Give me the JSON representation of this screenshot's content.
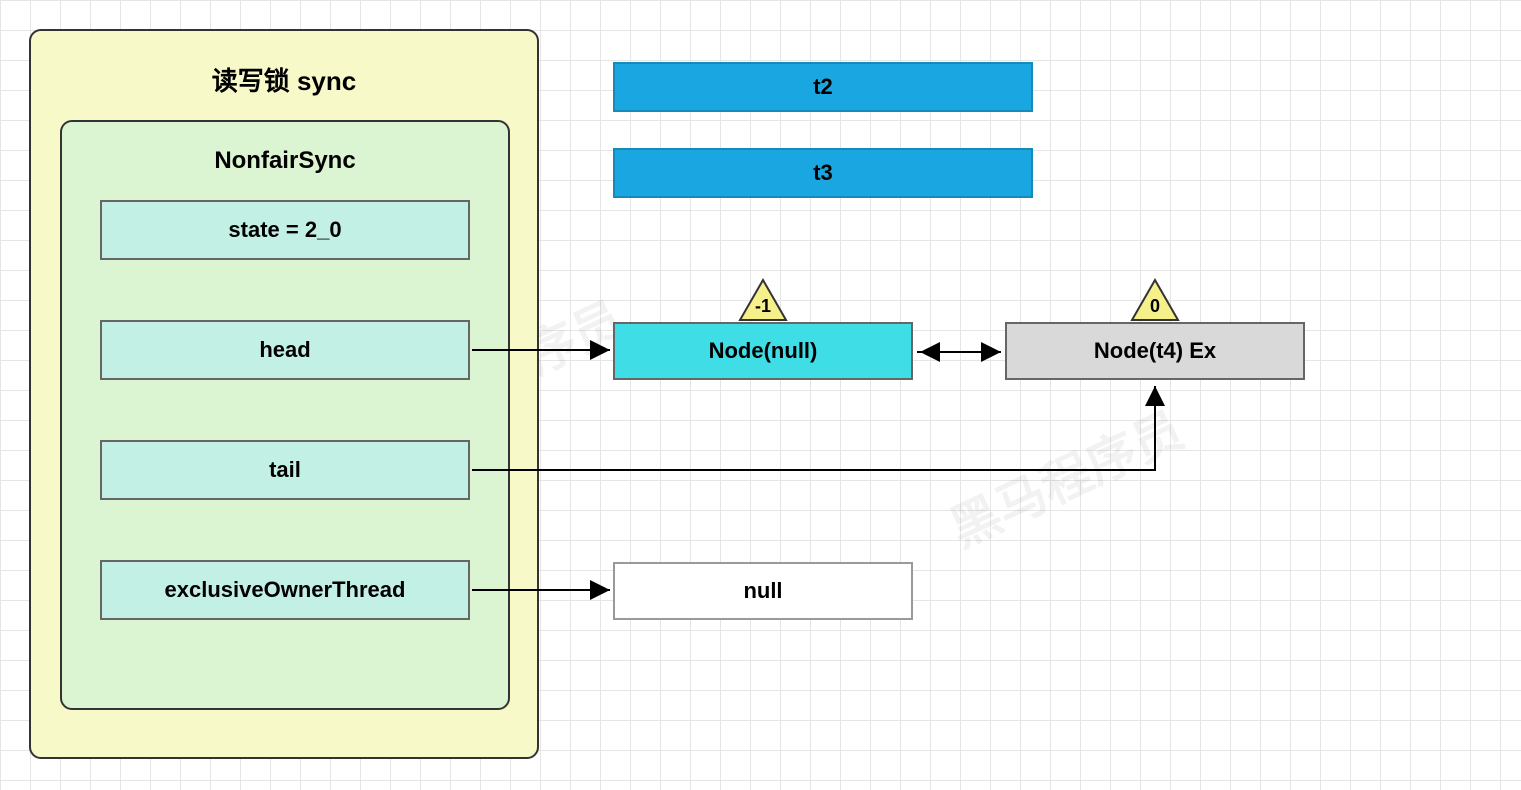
{
  "sync": {
    "title": "读写锁 sync",
    "nonfair": {
      "title": "NonfairSync",
      "state": "state = 2_0",
      "head": "head",
      "tail": "tail",
      "owner": "exclusiveOwnerThread"
    }
  },
  "threads": {
    "t2": "t2",
    "t3": "t3"
  },
  "nodes": {
    "null": {
      "label": "Node(null)",
      "badge": "-1"
    },
    "t4": {
      "label": "Node(t4) Ex",
      "badge": "0"
    }
  },
  "owner_target": "null",
  "watermark": "黑马程序员"
}
